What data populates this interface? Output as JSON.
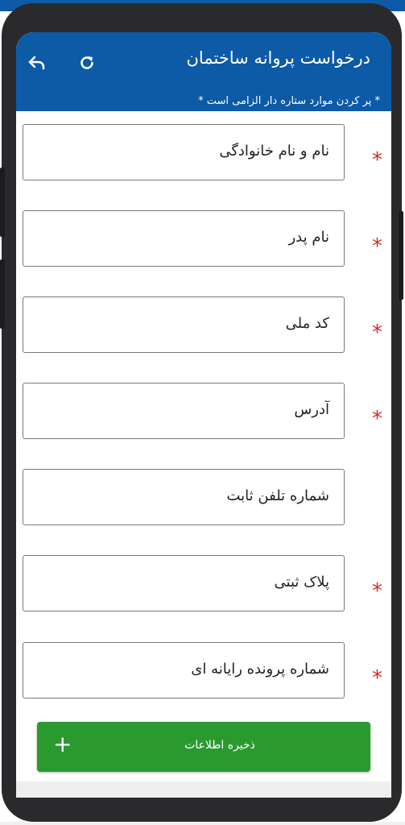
{
  "app": {
    "title": "درخواست پروانه ساختمان",
    "required_hint": "* پر کردن موارد ستاره دار الزامی است *",
    "back_icon": "back-arrow-icon",
    "refresh_icon": "refresh-icon",
    "bar_color": "#0d5aa7"
  },
  "form": {
    "fields": [
      {
        "label": "نام و نام خانوادگی",
        "required": true
      },
      {
        "label": "نام پدر",
        "required": true
      },
      {
        "label": "کد ملی",
        "required": true
      },
      {
        "label": "آدرس",
        "required": true
      },
      {
        "label": "شماره تلفن ثابت",
        "required": false
      },
      {
        "label": "پلاک ثبتی",
        "required": true
      },
      {
        "label": "شماره پرونده رایانه ای",
        "required": true
      }
    ],
    "required_mark": "*",
    "required_color": "#d62b2b"
  },
  "save": {
    "label": "ذخیره اطلاعات",
    "icon": "plus-icon",
    "plus_glyph": "+",
    "color": "#2a9a2f"
  }
}
